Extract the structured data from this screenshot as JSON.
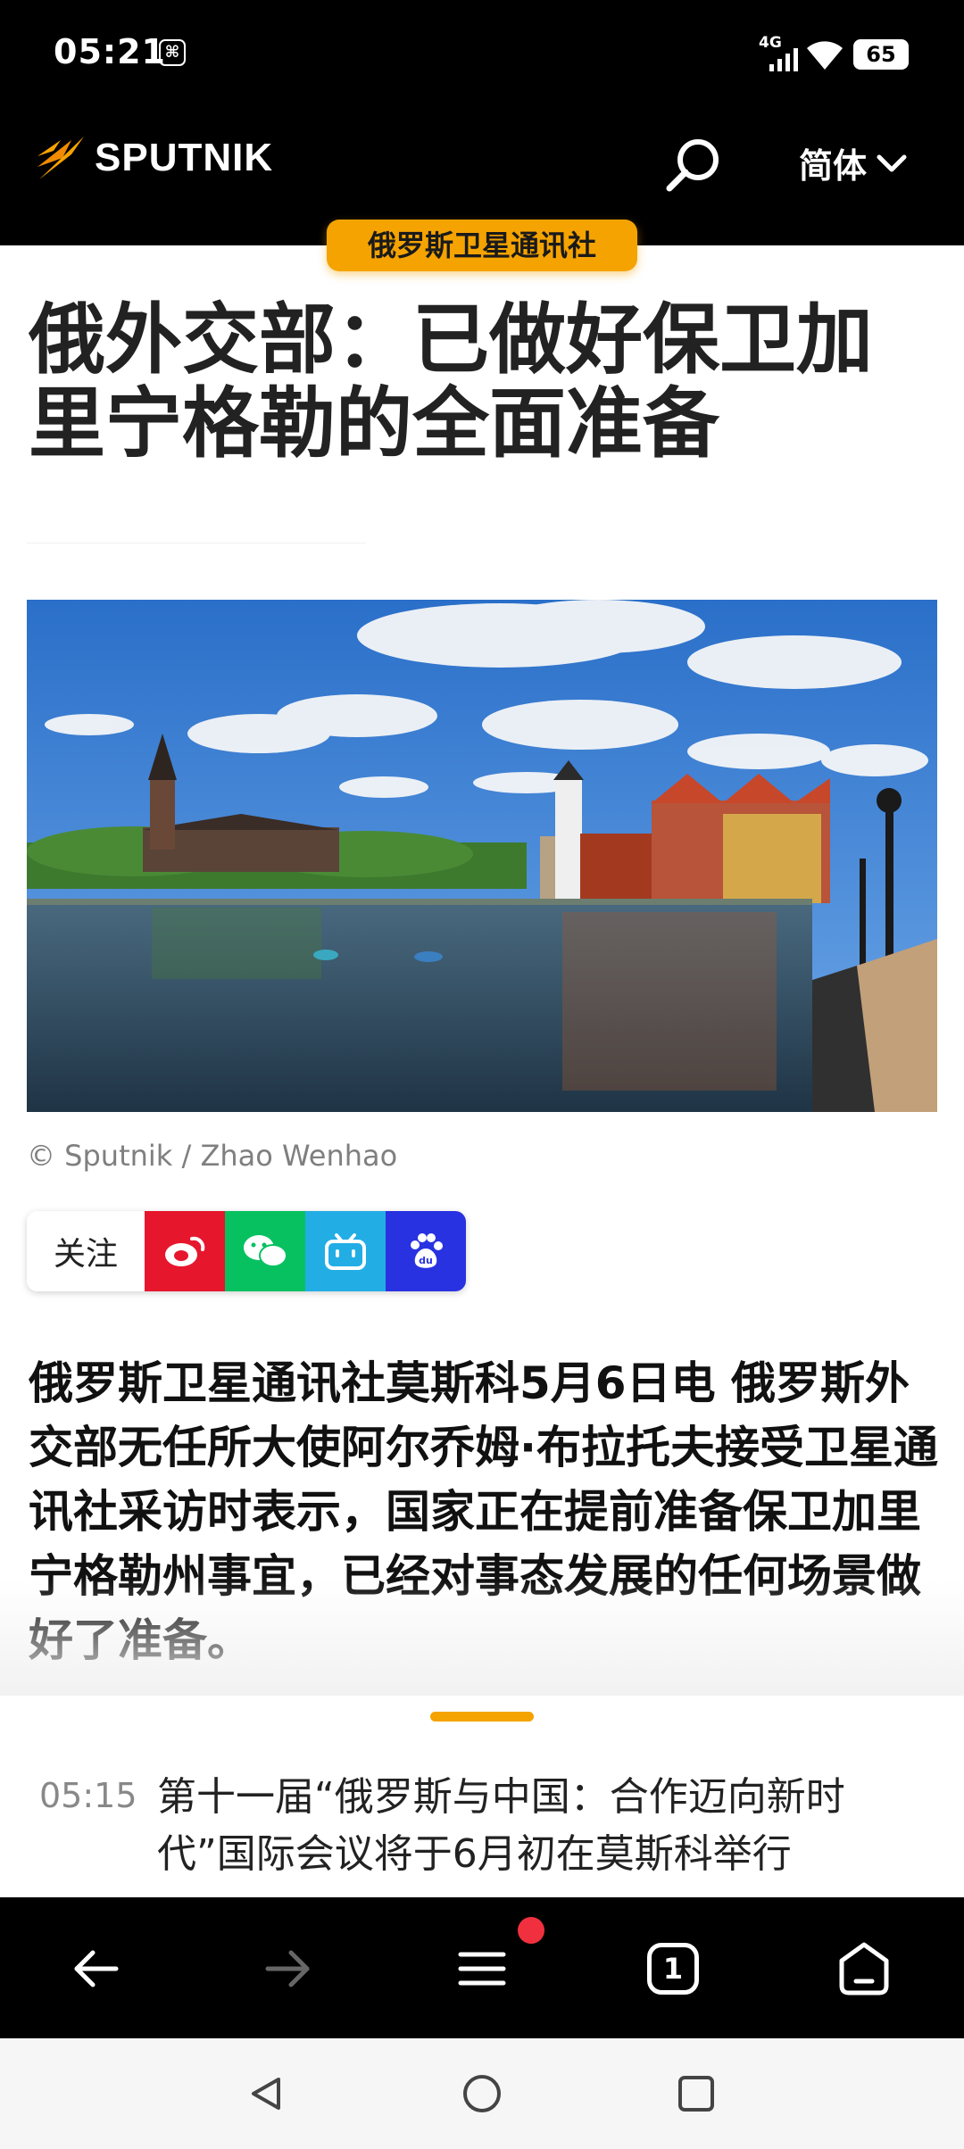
{
  "status_bar": {
    "time": "05:21",
    "notification_icon": "screen-record-icon",
    "network": "4G",
    "battery": "65"
  },
  "header": {
    "logo_text": "SPUTNIK",
    "language": "简体",
    "search_icon": "search-icon",
    "colors": {
      "background": "#000000",
      "accent": "#f5a300"
    }
  },
  "article": {
    "section": "俄罗斯卫星通讯社",
    "title": "俄外交部：已做好保卫加里宁格勒的全面准备",
    "photo_credit": "© Sputnik / Zhao Wenhao",
    "lead": "俄罗斯卫星通讯社莫斯科5月6日电 俄罗斯外交部无任所大使阿尔乔姆·布拉托夫接受卫星通讯社采访时表示，国家正在提前准备保卫加里宁格勒州事宜，已经对事态发展的任何场景做好了准备。"
  },
  "follow": {
    "label": "关注",
    "channels": [
      {
        "name": "weibo",
        "icon": "weibo-icon",
        "color": "#e6162d"
      },
      {
        "name": "wechat",
        "icon": "wechat-icon",
        "color": "#07c160"
      },
      {
        "name": "bilibili",
        "icon": "bilibili-icon",
        "color": "#23ade5"
      },
      {
        "name": "baidu",
        "icon": "baidu-icon",
        "color": "#2932e1"
      }
    ]
  },
  "ticker": {
    "time": "05:15",
    "text": "第十一届“俄罗斯与中国：合作迈向新时代”国际会议将于6月初在莫斯科举行"
  },
  "browser_nav": {
    "tab_count": "1",
    "menu_has_notification": true
  }
}
